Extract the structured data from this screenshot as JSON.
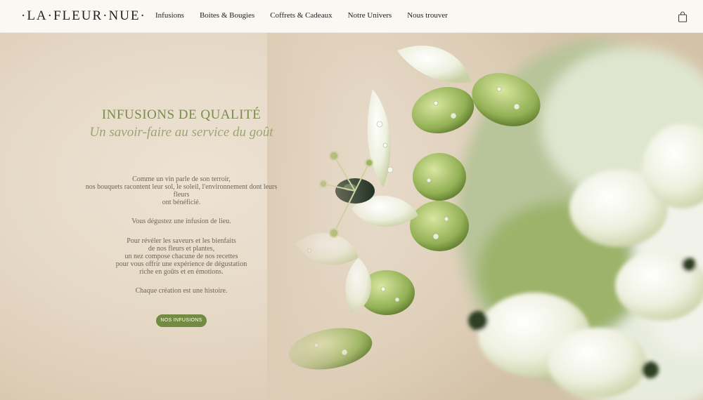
{
  "header": {
    "logo": "·LA·FLEUR·NUE·",
    "nav": [
      "Infusions",
      "Boites & Bougies",
      "Coffrets & Cadeaux",
      "Notre Univers",
      "Nous trouver"
    ],
    "cart_icon": "shopping-bag-icon"
  },
  "hero": {
    "title": "INFUSIONS DE QUALITÉ",
    "subtitle": "Un savoir-faire au service du goût",
    "paragraph1": [
      "Comme un vin parle de son terroir,",
      "nos bouquets racontent leur sol, le soleil, l'environnement dont leurs",
      "fleurs",
      "ont bénéficié."
    ],
    "paragraph2": "Vous dégustez une infusion de lieu.",
    "paragraph3": [
      "Pour révéler les saveurs et les bienfaits",
      "de nos fleurs et plantes,",
      "un nez compose chacune de nos recettes",
      "pour vous offrir une expérience de dégustation",
      "riche en goûts et en émotions."
    ],
    "paragraph4": "Chaque création est une histoire.",
    "cta": "NOS INFUSIONS"
  },
  "colors": {
    "accent": "#738a43",
    "title": "#7a8c4e",
    "body_text": "#6f6658"
  }
}
